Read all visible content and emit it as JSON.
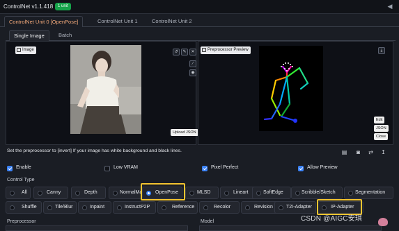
{
  "header": {
    "title": "ControlNet v1.1.418",
    "badge": "1 unit",
    "caret": "◀"
  },
  "tabs": [
    {
      "label": "ControlNet Unit 0 [OpenPose]"
    },
    {
      "label": "ControlNet Unit 1"
    },
    {
      "label": "ControlNet Unit 2"
    }
  ],
  "subtabs": [
    {
      "label": "Single Image"
    },
    {
      "label": "Batch"
    }
  ],
  "image_panel": {
    "chip": "Image",
    "upload_json": "Upload JSON"
  },
  "preview_panel": {
    "chip": "Preprocessor Preview",
    "edit": "Edit",
    "json": "JSON",
    "close": "Close"
  },
  "hint": "Set the preprocessor to [invert] If your image has white background and black lines.",
  "checks": [
    {
      "label": "Enable",
      "checked": true
    },
    {
      "label": "Low VRAM",
      "checked": false
    },
    {
      "label": "Pixel Perfect",
      "checked": true
    },
    {
      "label": "Allow Preview",
      "checked": true
    }
  ],
  "control_type": {
    "label": "Control Type",
    "row1": [
      "All",
      "Canny",
      "Depth",
      "NormalMap",
      "OpenPose",
      "MLSD",
      "Lineart",
      "SoftEdge",
      "Scribble/Sketch",
      "Segmentation"
    ],
    "row2": [
      "Shuffle",
      "Tile/Blur",
      "Inpaint",
      "InstructP2P",
      "Reference",
      "Recolor",
      "Revision",
      "T2I-Adapter",
      "IP-Adapter"
    ],
    "selected": "OpenPose"
  },
  "footer": {
    "preprocessor": "Preprocessor",
    "model": "Model"
  },
  "watermark": "CSDN @AIGC安琪",
  "colors": {
    "accent": "#3b82f6",
    "highlight": "#f4c430",
    "badge": "#16a34a",
    "tab_active": "#f2a97a"
  }
}
